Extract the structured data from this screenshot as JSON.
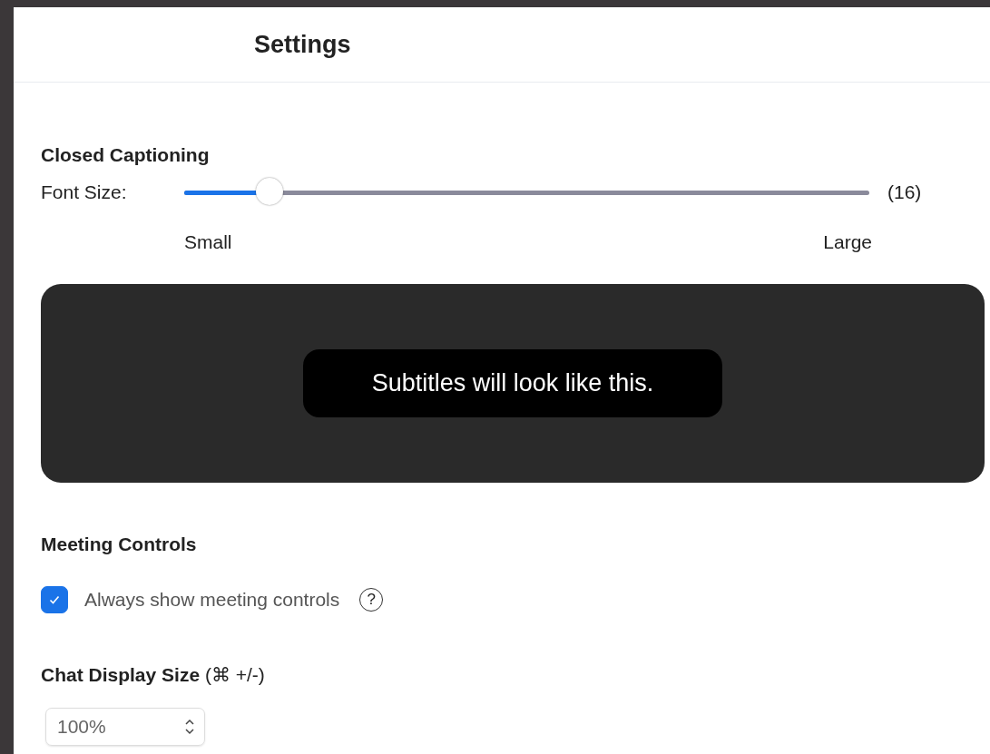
{
  "window": {
    "title": "Settings"
  },
  "closed_captioning": {
    "heading": "Closed Captioning",
    "font_size": {
      "label": "Font Size:",
      "level": 0.125,
      "reading": "(16)",
      "min_label": "Small",
      "max_label": "Large"
    },
    "preview_text": "Subtitles will look like this."
  },
  "meeting_controls": {
    "heading": "Meeting Controls",
    "options": [
      {
        "label": "Always show meeting controls",
        "checked": true,
        "help": "?"
      }
    ]
  },
  "chat_display_size": {
    "heading": "**Chat Display Size** (⌘ +/-)",
    "value": "100%"
  }
}
